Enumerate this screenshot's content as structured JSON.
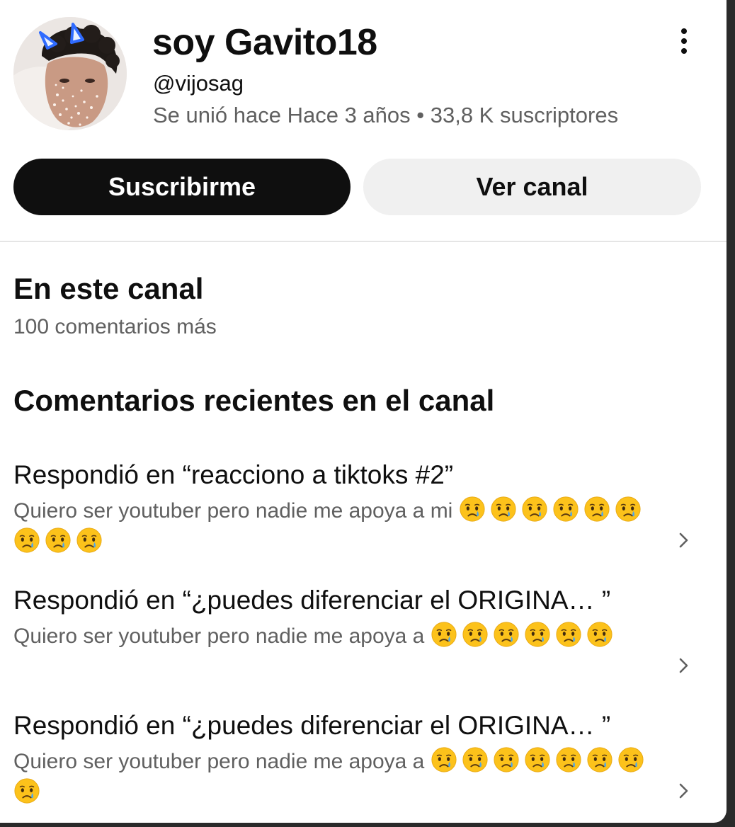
{
  "channel": {
    "name": "soy Gavito18",
    "handle": "@vijosag",
    "meta": "Se unió hace Hace 3 años • 33,8 K suscriptores"
  },
  "actions": {
    "subscribe_label": "Suscribirme",
    "view_channel_label": "Ver canal"
  },
  "on_channel": {
    "title": "En este canal",
    "count": "100 comentarios más"
  },
  "recent": {
    "title": "Comentarios recientes en el canal",
    "items": [
      {
        "title": "Respondió en “reacciono a tiktoks #2”",
        "text": "Quiero ser youtuber pero nadie me apoya a mi",
        "emoji_count": 9,
        "emoji": "crying-face"
      },
      {
        "title": "Respondió en “¿puedes diferenciar el ORIGINA… ”",
        "text": "Quiero ser youtuber pero nadie me apoya a",
        "emoji_count": 6,
        "emoji": "crying-face"
      },
      {
        "title": "Respondió en “¿puedes diferenciar el ORIGINA… ”",
        "text": "Quiero ser youtuber pero nadie me apoya a",
        "emoji_count": 8,
        "emoji": "crying-face"
      }
    ]
  },
  "icons": {
    "more": "more-vertical-icon",
    "chevron": "chevron-right-icon",
    "emoji": "crying-face-emoji"
  },
  "colors": {
    "primary_text": "#0f0f0f",
    "secondary_text": "#606060",
    "subscribe_bg": "#0f0f0f",
    "secondary_btn_bg": "#f0f0f0",
    "devil_horns": "#2f6bff"
  }
}
